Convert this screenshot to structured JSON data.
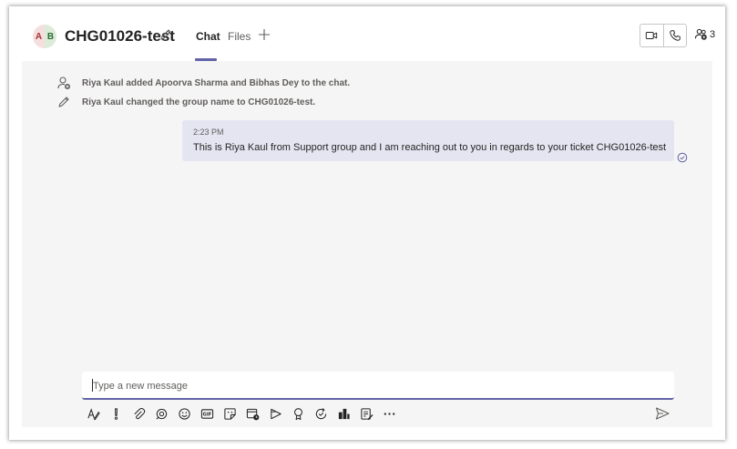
{
  "header": {
    "avatar_initials": [
      "A",
      "B"
    ],
    "title": "CHG01026-test",
    "tabs": [
      {
        "label": "Chat",
        "active": true
      },
      {
        "label": "Files",
        "active": false
      }
    ],
    "participant_count": "3"
  },
  "system_messages": [
    {
      "icon": "person-add-icon",
      "text": "Riya Kaul added Apoorva Sharma and Bibhas Dey to the chat."
    },
    {
      "icon": "pencil-icon",
      "text": "Riya Kaul changed the group name to CHG01026-test."
    }
  ],
  "message": {
    "time": "2:23 PM",
    "text": "This is Riya Kaul from Support group and I am reaching out to you in regards to your ticket CHG01026-test"
  },
  "composer": {
    "placeholder": "Type a new message",
    "value": ""
  },
  "toolbar_icons": [
    "format-icon",
    "important-icon",
    "attach-icon",
    "loop-icon",
    "emoji-icon",
    "gif-icon",
    "sticker-icon",
    "schedule-meeting-icon",
    "stream-icon",
    "praise-icon",
    "updates-icon",
    "app-icon",
    "approvals-icon",
    "more-options-icon"
  ],
  "colors": {
    "accent": "#6264a7",
    "bubble": "#e5e5f1",
    "background": "#f5f5f5"
  }
}
